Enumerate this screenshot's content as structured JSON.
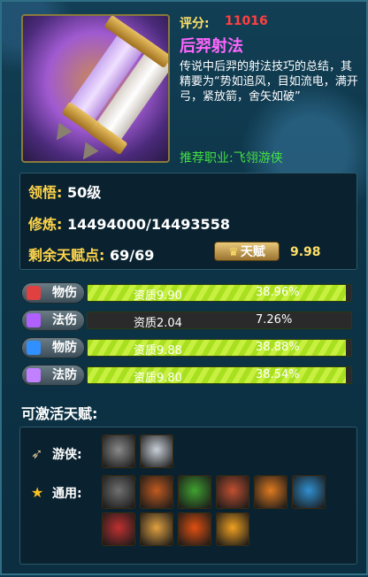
{
  "header": {
    "score_label": "评分:",
    "score_value": "11016",
    "item_name": "后羿射法",
    "description": "传说中后羿的射法技巧的总结，其精要为“势如追风，目如流电，满开弓，紧放箭，舍矢如破”",
    "recommend": "推荐职业:飞翎游侠"
  },
  "stats": {
    "comprehension_label": "领悟:",
    "comprehension_value": "50级",
    "cultivation_label": "修炼:",
    "cultivation_value": "14494000/14493558",
    "talent_points_label": "剩余天赋点:",
    "talent_points_value": "69/69",
    "talent_button": "天赋",
    "talent_score": "9.98"
  },
  "attributes": [
    {
      "label": "物伤",
      "aptitude": "资质9.90",
      "percent": "38.96%",
      "fill": 0.98,
      "icon_color": "#e04040",
      "icon": "sword-icon"
    },
    {
      "label": "法伤",
      "aptitude": "资质2.04",
      "percent": "7.26%",
      "fill": 0.0,
      "icon_color": "#b060ff",
      "icon": "magic-bolt-icon"
    },
    {
      "label": "物防",
      "aptitude": "资质9.88",
      "percent": "38.88%",
      "fill": 0.98,
      "icon_color": "#3090ff",
      "icon": "shield-icon"
    },
    {
      "label": "法防",
      "aptitude": "资质9.80",
      "percent": "38.54%",
      "fill": 0.98,
      "icon_color": "#c080ff",
      "icon": "magic-shield-icon"
    }
  ],
  "talents": {
    "title": "可激活天赋:",
    "ranger_label": "游侠:",
    "general_label": "通用:",
    "ranger_icon": "bow-icon",
    "general_icon": "star-icon",
    "ranger_skill_colors": [
      "#8a8a8a",
      "#c8d0d8"
    ],
    "general_skill_colors": [
      "#707070",
      "#c05a20",
      "#40a030",
      "#c05030",
      "#e07a20",
      "#3090d0",
      "#c03030",
      "#e0a040",
      "#e05010",
      "#f0a020"
    ]
  }
}
